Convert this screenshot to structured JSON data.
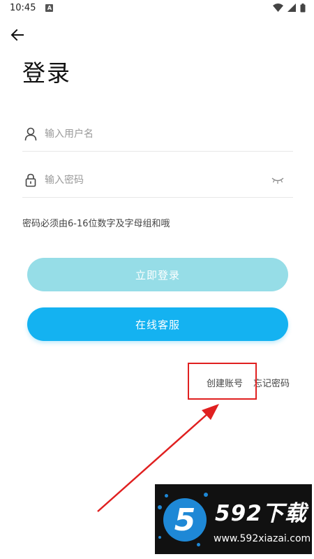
{
  "status_bar": {
    "time": "10:45"
  },
  "page": {
    "title": "登录"
  },
  "username_field": {
    "placeholder": "输入用户名"
  },
  "password_field": {
    "placeholder": "输入密码"
  },
  "hint": "密码必须由6-16位数字及字母组和哦",
  "buttons": {
    "login": "立即登录",
    "service": "在线客服"
  },
  "links": {
    "create_account": "创建账号",
    "forgot_password": "忘记密码"
  },
  "watermark": {
    "brand": "592下载",
    "url": "www.592xiazai.com",
    "digit": "5"
  },
  "colors": {
    "login_button": "#96dde7",
    "service_button": "#14b2f1",
    "annotation": "#e02020"
  },
  "icons": {
    "back": "arrow-left-icon",
    "user": "user-icon",
    "lock": "lock-icon",
    "eye": "eye-closed-icon"
  }
}
